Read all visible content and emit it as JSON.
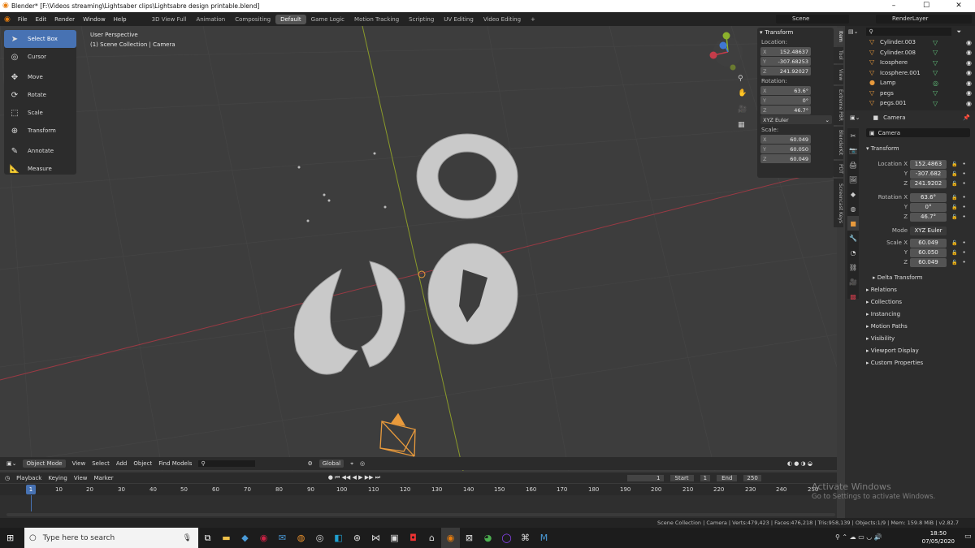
{
  "window": {
    "title": "Blender* [F:\\Videos streaming\\Lightsaber clips\\Lightsabre design printable.blend]",
    "minimize": "–",
    "maximize": "☐",
    "close": "✕"
  },
  "menu": [
    "File",
    "Edit",
    "Render",
    "Window",
    "Help"
  ],
  "workspaces": [
    "3D View Full",
    "Animation",
    "Compositing",
    "Default",
    "Game Logic",
    "Motion Tracking",
    "Scripting",
    "UV Editing",
    "Video Editing",
    "+"
  ],
  "scene": {
    "label": "Scene",
    "render_layer": "RenderLayer"
  },
  "tools": [
    {
      "label": "Select Box",
      "icon": "cursor-icon"
    },
    {
      "label": "Cursor",
      "icon": "3d-cursor-icon"
    },
    {
      "label": "Move",
      "icon": "move-icon"
    },
    {
      "label": "Rotate",
      "icon": "rotate-icon"
    },
    {
      "label": "Scale",
      "icon": "scale-icon"
    },
    {
      "label": "Transform",
      "icon": "transform-icon"
    },
    {
      "label": "Annotate",
      "icon": "pencil-icon"
    },
    {
      "label": "Measure",
      "icon": "ruler-icon"
    }
  ],
  "viewport": {
    "perspective": "User Perspective",
    "collection": "(1) Scene Collection | Camera"
  },
  "npanel": {
    "header": "Transform",
    "location_label": "Location:",
    "rotation_label": "Rotation:",
    "scale_label": "Scale:",
    "mode": "XYZ Euler",
    "loc": {
      "x": "152.48637",
      "y": "-307.68253",
      "z": "241.92027"
    },
    "rot": {
      "x": "63.6°",
      "y": "0°",
      "z": "46.7°"
    },
    "scale": {
      "x": "60.049",
      "y": "60.050",
      "z": "60.049"
    },
    "tabs": [
      "Item",
      "Tool",
      "View",
      "Extreme PBR",
      "BlenderKit",
      "PDT",
      "Screencast Keys"
    ]
  },
  "vp_header": {
    "mode": "Object Mode",
    "menus": [
      "View",
      "Select",
      "Add",
      "Object"
    ],
    "find": "Find Models",
    "orientation": "Global"
  },
  "timeline": {
    "menus": [
      "Playback",
      "Keying",
      "View",
      "Marker"
    ],
    "frame": "1",
    "start_label": "Start",
    "start": "1",
    "end_label": "End",
    "end": "250",
    "ticks": [
      "1",
      "10",
      "20",
      "30",
      "40",
      "50",
      "60",
      "70",
      "80",
      "90",
      "100",
      "110",
      "120",
      "130",
      "140",
      "150",
      "160",
      "170",
      "180",
      "190",
      "200",
      "210",
      "220",
      "230",
      "240",
      "250"
    ]
  },
  "statusbar": "Scene Collection | Camera | Verts:479,423 | Faces:476,218 | Tris:958,139 | Objects:1/9 | Mem: 159.8 MiB | v2.82.7",
  "outliner": {
    "items": [
      {
        "name": "Cylinder.003",
        "icon": "mesh-icon"
      },
      {
        "name": "Cylinder.008",
        "icon": "mesh-icon"
      },
      {
        "name": "Icosphere",
        "icon": "mesh-icon"
      },
      {
        "name": "Icosphere.001",
        "icon": "mesh-icon"
      },
      {
        "name": "Lamp",
        "icon": "lamp-icon"
      },
      {
        "name": "pegs",
        "icon": "mesh-icon"
      },
      {
        "name": "pegs.001",
        "icon": "mesh-icon"
      }
    ]
  },
  "properties": {
    "object": "Camera",
    "data_name": "Camera",
    "transform": "Transform",
    "loc": {
      "x": "152.4863",
      "y": "-307.682",
      "z": "241.9202"
    },
    "rot": {
      "x": "63.6°",
      "y": "0°",
      "z": "46.7°"
    },
    "mode_label": "Mode",
    "mode": "XYZ Euler",
    "scale": {
      "x": "60.049",
      "y": "60.050",
      "z": "60.049"
    },
    "labels": {
      "loc_x": "Location X",
      "rot_x": "Rotation X",
      "scale_x": "Scale X",
      "y": "Y",
      "z": "Z"
    },
    "delta": "Delta Transform",
    "sections": [
      "Relations",
      "Collections",
      "Instancing",
      "Motion Paths",
      "Visibility",
      "Viewport Display",
      "Custom Properties"
    ]
  },
  "taskbar": {
    "search": "Type here to search",
    "time": "18:50",
    "date": "07/05/2020"
  },
  "activate": {
    "title": "Activate Windows",
    "sub": "Go to Settings to activate Windows."
  },
  "colors": {
    "accent": "#4772b3",
    "orange": "#e89a3c",
    "x_axis": "#c53c4a",
    "y_axis": "#8bb12c",
    "z_axis": "#3f77d4"
  }
}
